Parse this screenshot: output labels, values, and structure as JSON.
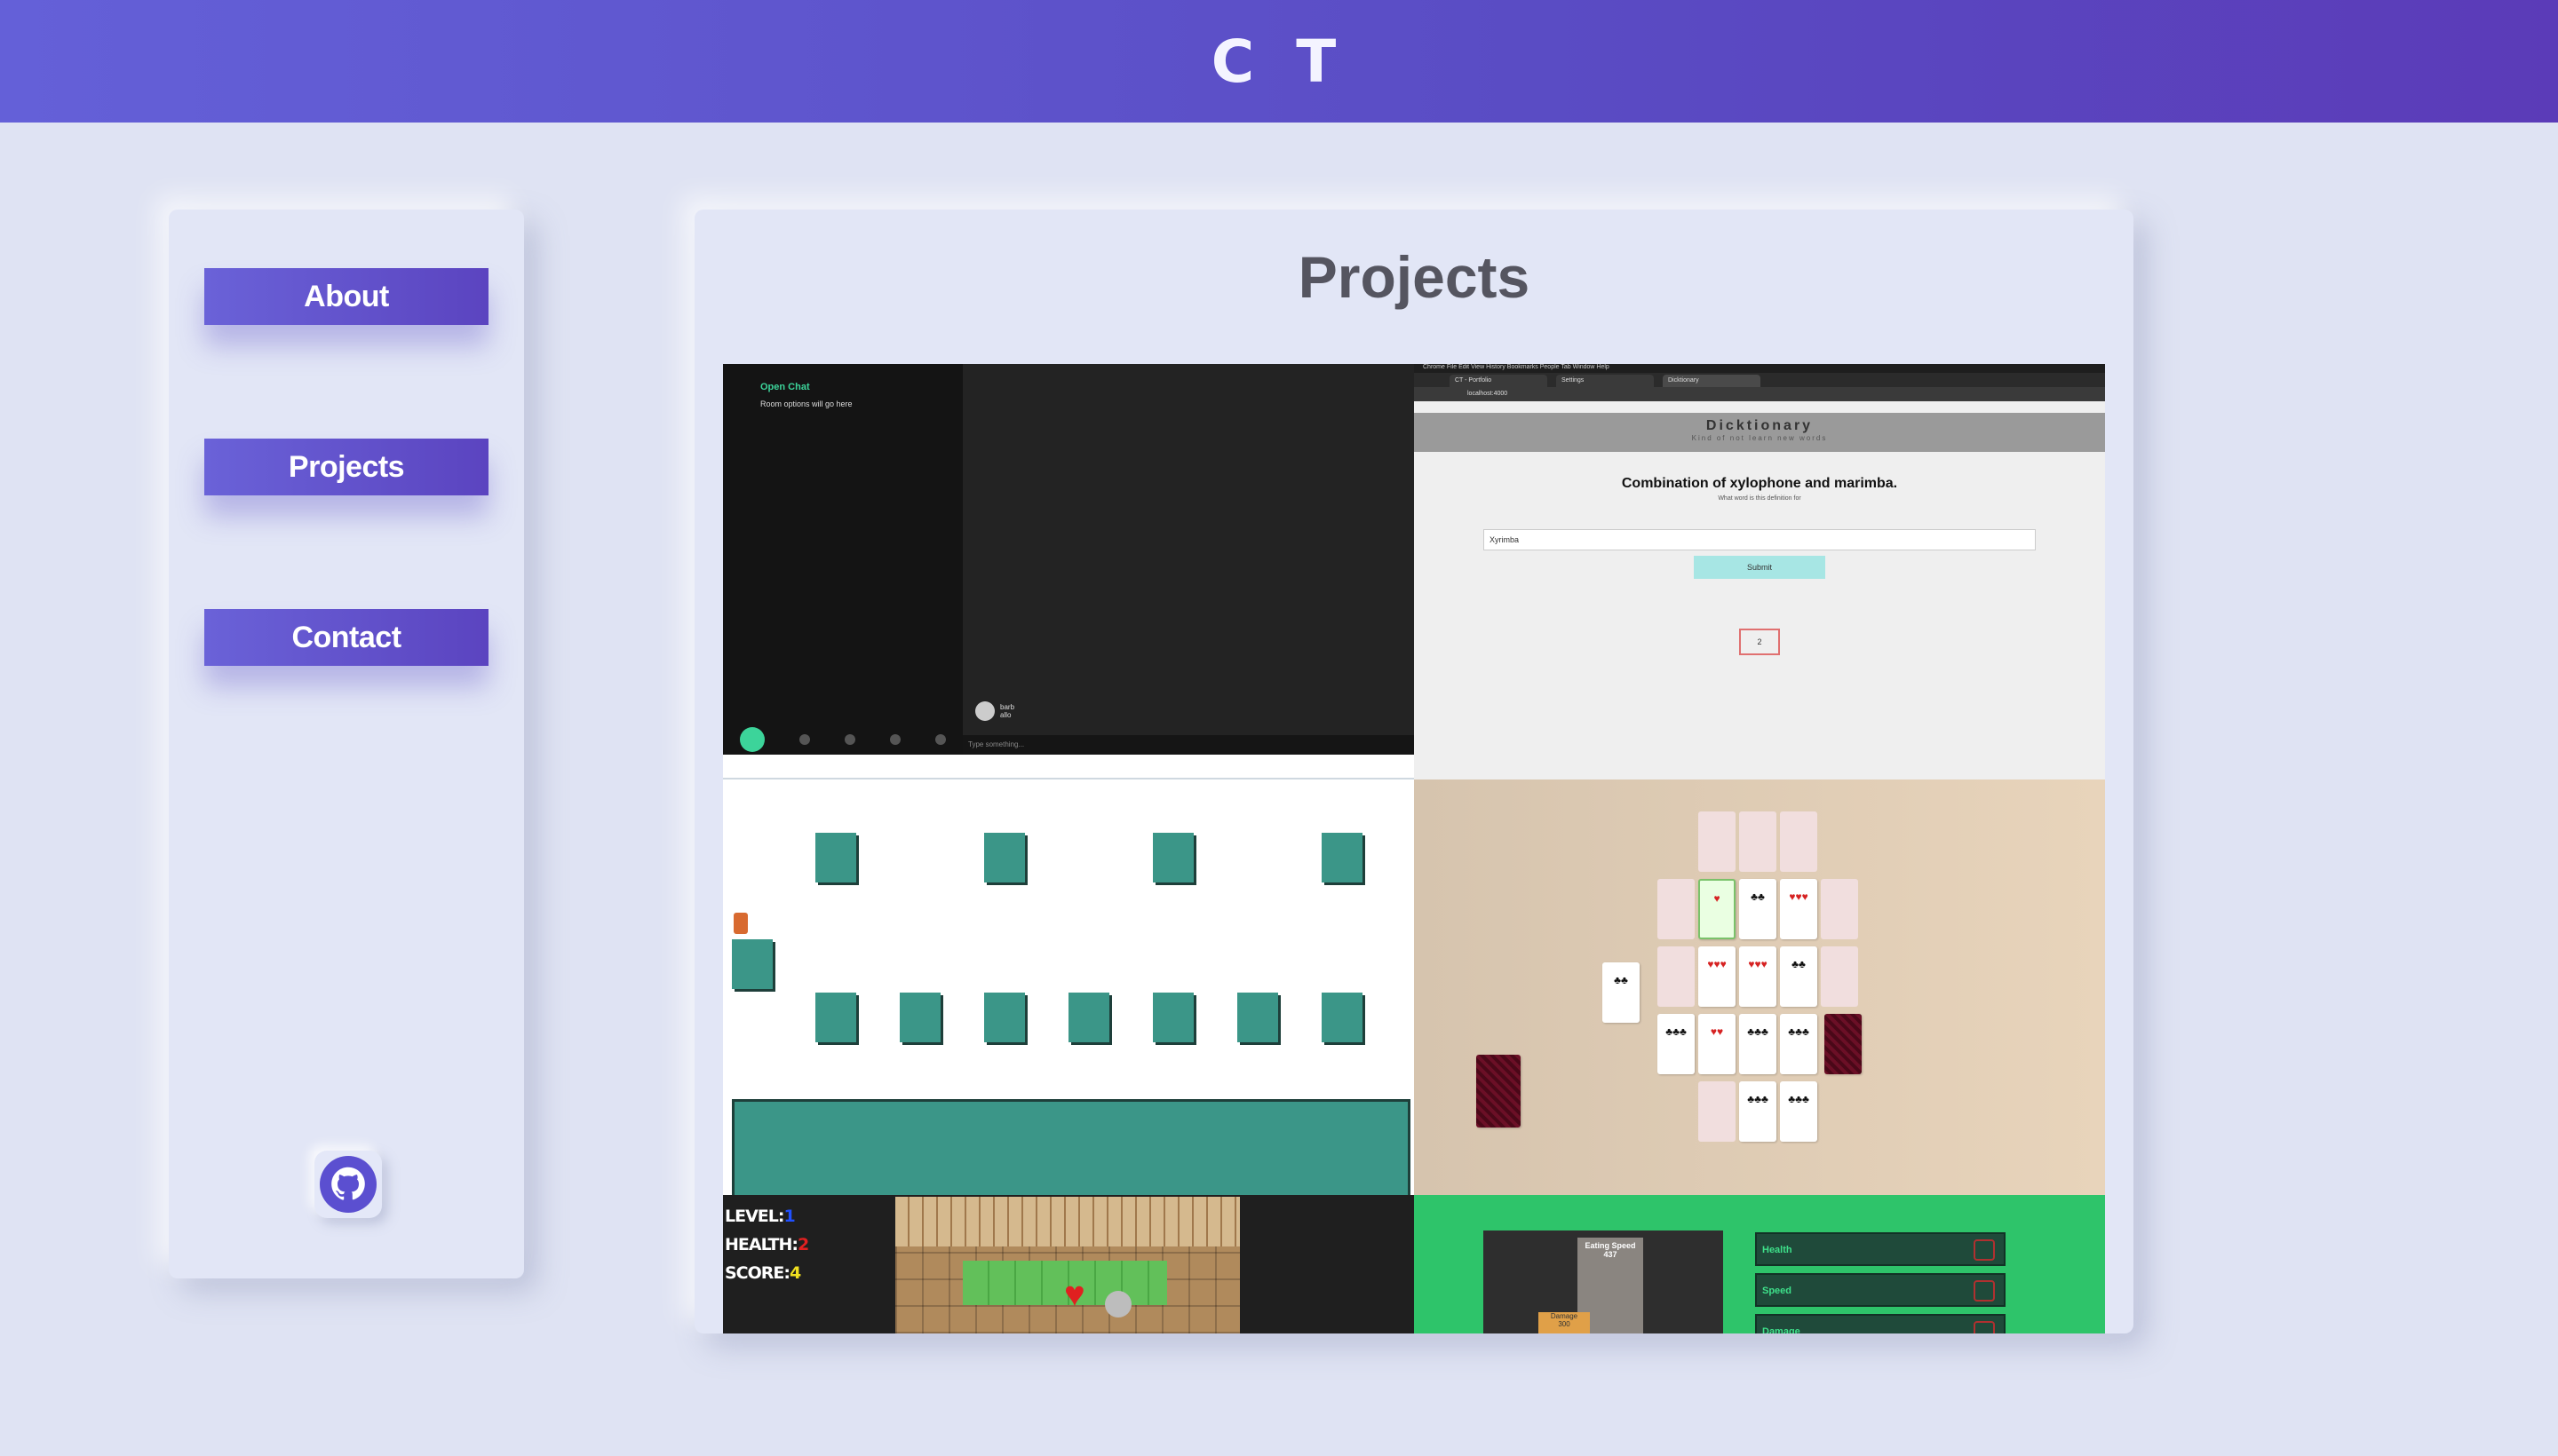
{
  "header": {
    "logo": "C T"
  },
  "sidebar": {
    "nav": [
      {
        "label": "About"
      },
      {
        "label": "Projects"
      },
      {
        "label": "Contact"
      }
    ],
    "github_icon": "github-icon"
  },
  "main": {
    "title": "Projects",
    "projects": {
      "chat": {
        "open_chat": "Open Chat",
        "room_options": "Room options will go here",
        "user": "barb",
        "user_msg": "allo",
        "input_placeholder": "Type something..."
      },
      "dicktionary": {
        "menu": "Chrome  File  Edit  View  History  Bookmarks  People  Tab  Window  Help",
        "tab1": "CT - Portfolio",
        "tab2": "Settings",
        "tab3": "Dicktionary",
        "url": "localhost:4000",
        "title": "Dicktionary",
        "tagline": "Kind of not learn new words",
        "definition": "Combination of xylophone and marimba.",
        "subtitle": "What word is this definition for",
        "input_value": "Xyrimba",
        "submit": "Submit",
        "counter": "2"
      },
      "dungeon": {
        "level_label": "LEVEL:",
        "level_value": "1",
        "health_label": "HEALTH:",
        "health_value": "2",
        "score_label": "SCORE:",
        "score_value": "4"
      },
      "stats": {
        "eating_speed_label": "Eating Speed",
        "eating_speed_value": "437",
        "damage_box_label": "Damage",
        "damage_box_value": "300",
        "stats": [
          "Health",
          "Speed",
          "Damage"
        ]
      }
    }
  },
  "colors": {
    "header_start": "#6460d8",
    "header_end": "#5b3bb8",
    "background": "#dfe3f3",
    "button_gradient_start": "#6a62d8",
    "button_gradient_end": "#5b44c0",
    "title_text": "#555560"
  }
}
